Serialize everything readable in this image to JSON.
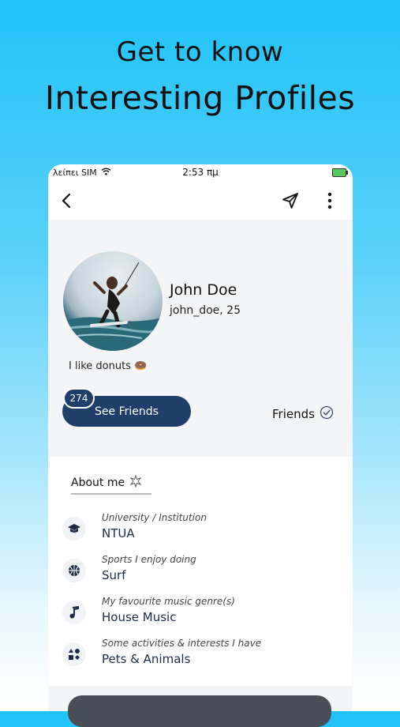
{
  "promo": {
    "line1": "Get to know",
    "line2": "Interesting Profiles"
  },
  "status_bar": {
    "carrier": "λείπει SIM",
    "time": "2:53 πμ",
    "wifi_icon": "wifi-icon",
    "battery_icon": "battery-charging-icon"
  },
  "nav": {
    "back_icon": "chevron-left-icon",
    "share_icon": "send-icon",
    "menu_icon": "more-vertical-icon"
  },
  "profile": {
    "name": "John Doe",
    "handle_age": "john_doe, 25",
    "bio": "I like donuts 🍩",
    "friends_count": "274",
    "see_friends_label": "See Friends",
    "friend_status": "Friends",
    "friend_status_icon": "check-circle-icon"
  },
  "about": {
    "title": "About me",
    "title_icon": "sparkle-icon",
    "items": [
      {
        "caption": "University / Institution",
        "value": "NTUA",
        "icon": "graduation-cap-icon"
      },
      {
        "caption": "Sports I enjoy doing",
        "value": "Surf",
        "icon": "basketball-icon"
      },
      {
        "caption": "My favourite music genre(s)",
        "value": "House Music",
        "icon": "music-note-icon"
      },
      {
        "caption": "Some activities & interests I have",
        "value": "Pets & Animals",
        "icon": "shapes-icon"
      }
    ]
  },
  "colors": {
    "accent": "#1f3f6a",
    "background_top": "#1fc3f7",
    "background_bottom": "#ffffff"
  }
}
